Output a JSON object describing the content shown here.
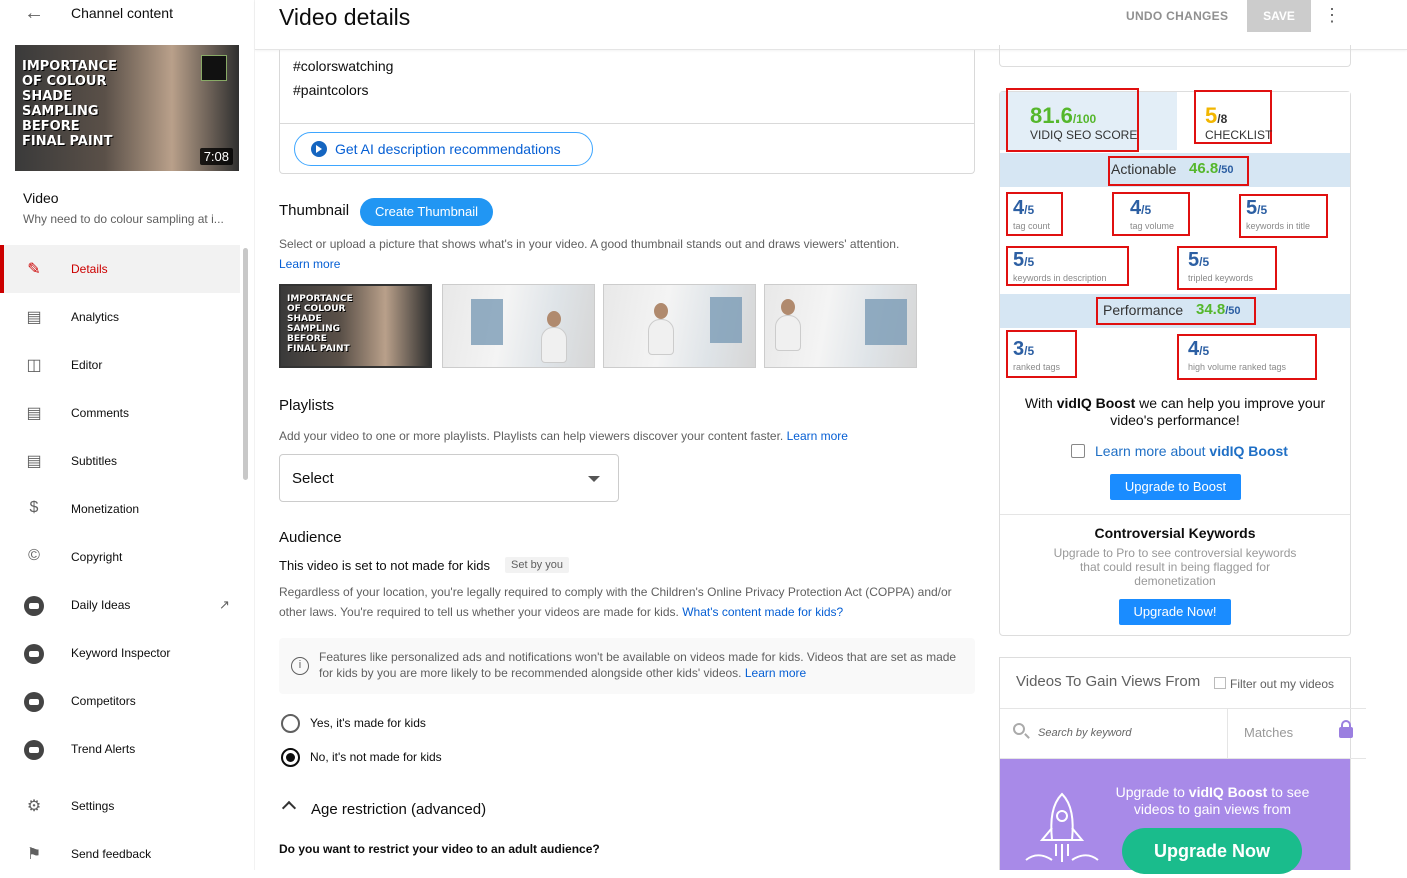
{
  "sidebar": {
    "back_label": "Channel content",
    "thumbnail": {
      "title_text": "IMPORTANCE OF COLOUR SHADE SAMPLING BEFORE FINAL PAINT",
      "duration": "7:08"
    },
    "video_label": "Video",
    "video_title": "Why need to do colour sampling at i...",
    "items": [
      {
        "label": "Details",
        "icon": "pencil-icon"
      },
      {
        "label": "Analytics",
        "icon": "analytics-icon"
      },
      {
        "label": "Editor",
        "icon": "editor-icon"
      },
      {
        "label": "Comments",
        "icon": "comments-icon"
      },
      {
        "label": "Subtitles",
        "icon": "subtitles-icon"
      },
      {
        "label": "Monetization",
        "icon": "dollar-icon"
      },
      {
        "label": "Copyright",
        "icon": "copyright-icon"
      },
      {
        "label": "Daily Ideas",
        "icon": "vidiq-icon"
      },
      {
        "label": "Keyword Inspector",
        "icon": "vidiq-icon"
      },
      {
        "label": "Competitors",
        "icon": "vidiq-icon"
      },
      {
        "label": "Trend Alerts",
        "icon": "vidiq-icon"
      },
      {
        "label": "Settings",
        "icon": "gear-icon"
      },
      {
        "label": "Send feedback",
        "icon": "feedback-icon"
      }
    ]
  },
  "header": {
    "title": "Video details",
    "undo_label": "UNDO CHANGES",
    "save_label": "SAVE"
  },
  "description": {
    "tags": [
      "#colorswatching",
      "#paintcolors"
    ],
    "ai_button": "Get AI description recommendations"
  },
  "thumbnail_section": {
    "title": "Thumbnail",
    "create_button": "Create Thumbnail",
    "desc": "Select or upload a picture that shows what's in your video. A good thumbnail stands out and draws viewers' attention.",
    "learn_more": "Learn more",
    "option_text": "IMPORTANCE OF COLOUR SHADE SAMPLING BEFORE FINAL PAINT"
  },
  "playlists": {
    "title": "Playlists",
    "desc": "Add your video to one or more playlists. Playlists can help viewers discover your content faster.",
    "learn_more": "Learn more",
    "select_value": "Select"
  },
  "audience": {
    "title": "Audience",
    "status": "This video is set to not made for kids",
    "set_by": "Set by you",
    "desc": "Regardless of your location, you're legally required to comply with the Children's Online Privacy Protection Act (COPPA) and/or other laws. You're required to tell us whether your videos are made for kids.",
    "desc_link": "What's content made for kids?",
    "info": "Features like personalized ads and notifications won't be available on videos made for kids. Videos that are set as made for kids by you are more likely to be recommended alongside other kids' videos.",
    "info_link": "Learn more",
    "option_yes": "Yes, it's made for kids",
    "option_no": "No, it's not made for kids",
    "selected": "no"
  },
  "age_restriction": {
    "title": "Age restriction (advanced)",
    "question": "Do you want to restrict your video to an adult audience?"
  },
  "vidiq": {
    "seo_score": "81.6",
    "seo_max": "/100",
    "seo_label": "VIDIQ SEO SCORE",
    "checklist_score": "5",
    "checklist_max": "/8",
    "checklist_label": "CHECKLIST",
    "actionable_label": "Actionable",
    "actionable_score": "46.8",
    "actionable_max": "/50",
    "performance_label": "Performance",
    "performance_score": "34.8",
    "performance_max": "/50",
    "metrics": [
      {
        "value": "4",
        "max": "/5",
        "label": "tag count"
      },
      {
        "value": "4",
        "max": "/5",
        "label": "tag volume"
      },
      {
        "value": "5",
        "max": "/5",
        "label": "keywords in title"
      },
      {
        "value": "5",
        "max": "/5",
        "label": "keywords in description"
      },
      {
        "value": "5",
        "max": "/5",
        "label": "tripled keywords"
      },
      {
        "value": "3",
        "max": "/5",
        "label": "ranked tags"
      },
      {
        "value": "4",
        "max": "/5",
        "label": "high volume ranked tags"
      }
    ],
    "boost_text_pre": "With ",
    "boost_brand": "vidIQ Boost",
    "boost_text_post": " we can help you improve your video's performance!",
    "boost_link_pre": "Learn more about ",
    "boost_link_brand": "vidIQ Boost",
    "upgrade_boost": "Upgrade to Boost",
    "controversial_title": "Controversial Keywords",
    "controversial_text": "Upgrade to Pro to see controversial keywords that could result in being flagged for demonetization",
    "upgrade_now": "Upgrade Now!",
    "views_title": "Videos To Gain Views From",
    "filter_label": "Filter out my videos",
    "search_placeholder": "Search by keyword",
    "matches_label": "Matches",
    "promo_pre": "Upgrade to ",
    "promo_brand": "vidIQ Boost",
    "promo_post": " to see videos to gain views from",
    "promo_button": "Upgrade Now",
    "colors": {
      "green": "#55b72c",
      "yellow": "#f2b600",
      "blue": "#2c5fa3",
      "highlight": "#e01010",
      "purple": "#a88ae8"
    }
  }
}
